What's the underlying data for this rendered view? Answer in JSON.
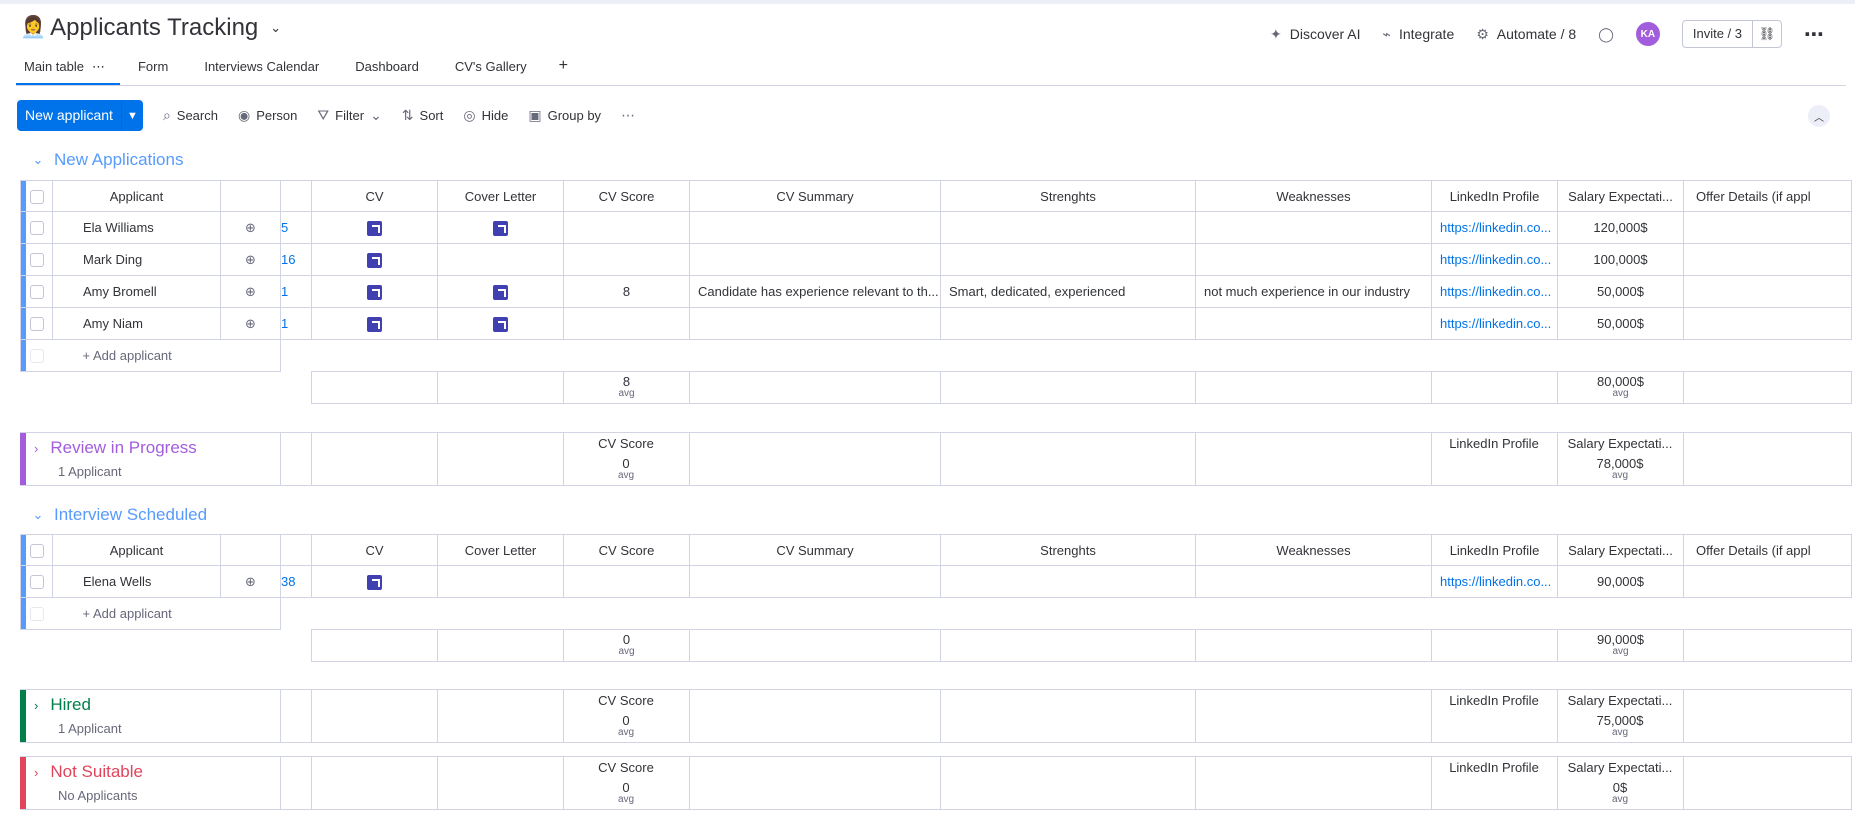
{
  "header": {
    "emoji": "👩‍💼",
    "title": "Applicants Tracking",
    "discover_ai": "Discover AI",
    "integrate": "Integrate",
    "automate": "Automate / 8",
    "avatar": "KA",
    "invite": "Invite / 3"
  },
  "tabs": {
    "main": "Main table",
    "form": "Form",
    "calendar": "Interviews Calendar",
    "dashboard": "Dashboard",
    "gallery": "CV's Gallery",
    "add": "+"
  },
  "toolbar": {
    "new_applicant": "New applicant",
    "search": "Search",
    "person": "Person",
    "filter": "Filter",
    "sort": "Sort",
    "hide": "Hide",
    "group_by": "Group by"
  },
  "columns": {
    "applicant": "Applicant",
    "cv": "CV",
    "cover_letter": "Cover Letter",
    "cv_score": "CV Score",
    "cv_summary": "CV Summary",
    "strengths": "Strenghts",
    "weaknesses": "Weaknesses",
    "linkedin": "LinkedIn Profile",
    "salary": "Salary Expectati...",
    "offer": "Offer Details (if appl"
  },
  "groups": {
    "new_applications": {
      "title": "New Applications",
      "color": "#579bfc",
      "rows": [
        {
          "name": "Ela Williams",
          "peek": "5",
          "cv": true,
          "cover": true,
          "score": "",
          "summary": "",
          "strengths": "",
          "weaknesses": "",
          "linkedin": "https://linkedin.co...",
          "salary": "120,000$"
        },
        {
          "name": "Mark Ding",
          "peek": "16",
          "cv": true,
          "cover": false,
          "score": "",
          "summary": "",
          "strengths": "",
          "weaknesses": "",
          "linkedin": "https://linkedin.co...",
          "salary": "100,000$"
        },
        {
          "name": "Amy Bromell",
          "peek": "1",
          "cv": true,
          "cover": true,
          "score": "8",
          "summary": "Candidate has experience relevant to th...",
          "strengths": "Smart, dedicated, experienced",
          "weaknesses": "not much experience in our industry",
          "linkedin": "https://linkedin.co...",
          "salary": "50,000$"
        },
        {
          "name": "Amy Niam",
          "peek": "1",
          "cv": true,
          "cover": true,
          "score": "",
          "summary": "",
          "strengths": "",
          "weaknesses": "",
          "linkedin": "https://linkedin.co...",
          "salary": "50,000$"
        }
      ],
      "add_label": "+ Add applicant",
      "summary_score": "8",
      "summary_salary": "80,000$",
      "avg": "avg"
    },
    "review": {
      "title": "Review in Progress",
      "color": "#a25ddc",
      "count": "1 Applicant",
      "score_label": "CV Score",
      "score": "0",
      "linkedin_label": "LinkedIn Profile",
      "salary_label": "Salary Expectati...",
      "salary": "78,000$",
      "avg": "avg"
    },
    "interview": {
      "title": "Interview Scheduled",
      "color": "#579bfc",
      "rows": [
        {
          "name": "Elena Wells",
          "peek": "38",
          "cv": true,
          "cover": false,
          "linkedin": "https://linkedin.co...",
          "salary": "90,000$"
        }
      ],
      "add_label": "+ Add applicant",
      "summary_score": "0",
      "summary_salary": "90,000$",
      "avg": "avg"
    },
    "hired": {
      "title": "Hired",
      "color": "#037f4c",
      "count": "1 Applicant",
      "score_label": "CV Score",
      "score": "0",
      "linkedin_label": "LinkedIn Profile",
      "salary_label": "Salary Expectati...",
      "salary": "75,000$",
      "avg": "avg"
    },
    "not_suitable": {
      "title": "Not Suitable",
      "color": "#e2445c",
      "count": "No Applicants",
      "score_label": "CV Score",
      "score": "0",
      "linkedin_label": "LinkedIn Profile",
      "salary_label": "Salary Expectati...",
      "salary": "0$",
      "avg": "avg"
    }
  }
}
